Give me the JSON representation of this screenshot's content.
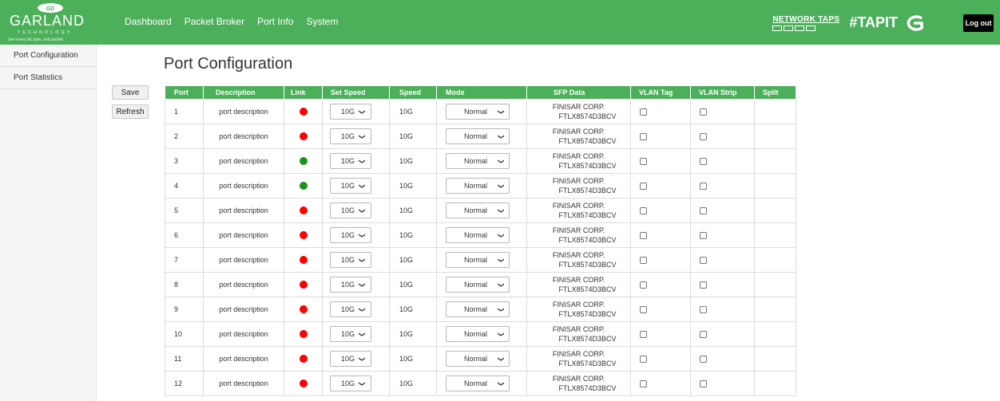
{
  "header": {
    "logo_text": "GARLAND",
    "logo_sub": "TECHNOLOGY",
    "logo_tagline": "See every bit, byte, and packet.",
    "nav": [
      "Dashboard",
      "Packet Broker",
      "Port Info",
      "System"
    ],
    "network_taps": "NETWORK TAPS",
    "tapit": "#TAPIT",
    "logout": "Log out",
    "brand_color": "#4cb05a"
  },
  "sidebar": {
    "items": [
      "Port Configuration",
      "Port Statistics"
    ]
  },
  "actions": {
    "save": "Save",
    "refresh": "Refresh"
  },
  "page": {
    "title": "Port Configuration"
  },
  "table": {
    "columns": [
      "Port",
      "Description",
      "Link",
      "Set Speed",
      "Speed",
      "Mode",
      "SFP Data",
      "VLAN Tag",
      "VLAN Strip",
      "Split"
    ],
    "rows": [
      {
        "port": "1",
        "desc": "port description",
        "link": "down",
        "set_speed": "10G",
        "speed": "10G",
        "mode": "Normal",
        "sfp1": "FINISAR CORP.",
        "sfp2": "FTLX8574D3BCV",
        "vlan_tag": false,
        "vlan_strip": false
      },
      {
        "port": "2",
        "desc": "port description",
        "link": "down",
        "set_speed": "10G",
        "speed": "10G",
        "mode": "Normal",
        "sfp1": "FINISAR CORP.",
        "sfp2": "FTLX8574D3BCV",
        "vlan_tag": false,
        "vlan_strip": false
      },
      {
        "port": "3",
        "desc": "port description",
        "link": "up",
        "set_speed": "10G",
        "speed": "10G",
        "mode": "Normal",
        "sfp1": "FINISAR CORP.",
        "sfp2": "FTLX8574D3BCV",
        "vlan_tag": false,
        "vlan_strip": false
      },
      {
        "port": "4",
        "desc": "port description",
        "link": "up",
        "set_speed": "10G",
        "speed": "10G",
        "mode": "Normal",
        "sfp1": "FINISAR CORP.",
        "sfp2": "FTLX8574D3BCV",
        "vlan_tag": false,
        "vlan_strip": false
      },
      {
        "port": "5",
        "desc": "port description",
        "link": "down",
        "set_speed": "10G",
        "speed": "10G",
        "mode": "Normal",
        "sfp1": "FINISAR CORP.",
        "sfp2": "FTLX8574D3BCV",
        "vlan_tag": false,
        "vlan_strip": false
      },
      {
        "port": "6",
        "desc": "port description",
        "link": "down",
        "set_speed": "10G",
        "speed": "10G",
        "mode": "Normal",
        "sfp1": "FINISAR CORP.",
        "sfp2": "FTLX8574D3BCV",
        "vlan_tag": false,
        "vlan_strip": false
      },
      {
        "port": "7",
        "desc": "port description",
        "link": "down",
        "set_speed": "10G",
        "speed": "10G",
        "mode": "Normal",
        "sfp1": "FINISAR CORP.",
        "sfp2": "FTLX8574D3BCV",
        "vlan_tag": false,
        "vlan_strip": false
      },
      {
        "port": "8",
        "desc": "port description",
        "link": "down",
        "set_speed": "10G",
        "speed": "10G",
        "mode": "Normal",
        "sfp1": "FINISAR CORP.",
        "sfp2": "FTLX8574D3BCV",
        "vlan_tag": false,
        "vlan_strip": false
      },
      {
        "port": "9",
        "desc": "port description",
        "link": "down",
        "set_speed": "10G",
        "speed": "10G",
        "mode": "Normal",
        "sfp1": "FINISAR CORP.",
        "sfp2": "FTLX8574D3BCV",
        "vlan_tag": false,
        "vlan_strip": false
      },
      {
        "port": "10",
        "desc": "port description",
        "link": "down",
        "set_speed": "10G",
        "speed": "10G",
        "mode": "Normal",
        "sfp1": "FINISAR CORP.",
        "sfp2": "FTLX8574D3BCV",
        "vlan_tag": false,
        "vlan_strip": false
      },
      {
        "port": "11",
        "desc": "port description",
        "link": "down",
        "set_speed": "10G",
        "speed": "10G",
        "mode": "Normal",
        "sfp1": "FINISAR CORP.",
        "sfp2": "FTLX8574D3BCV",
        "vlan_tag": false,
        "vlan_strip": false
      },
      {
        "port": "12",
        "desc": "port description",
        "link": "down",
        "set_speed": "10G",
        "speed": "10G",
        "mode": "Normal",
        "sfp1": "FINISAR CORP.",
        "sfp2": "FTLX8574D3BCV",
        "vlan_tag": false,
        "vlan_strip": false
      }
    ]
  },
  "colors": {
    "link_down": "#ff0000",
    "link_up": "#1f8f1f",
    "header_green": "#4cb05a"
  }
}
